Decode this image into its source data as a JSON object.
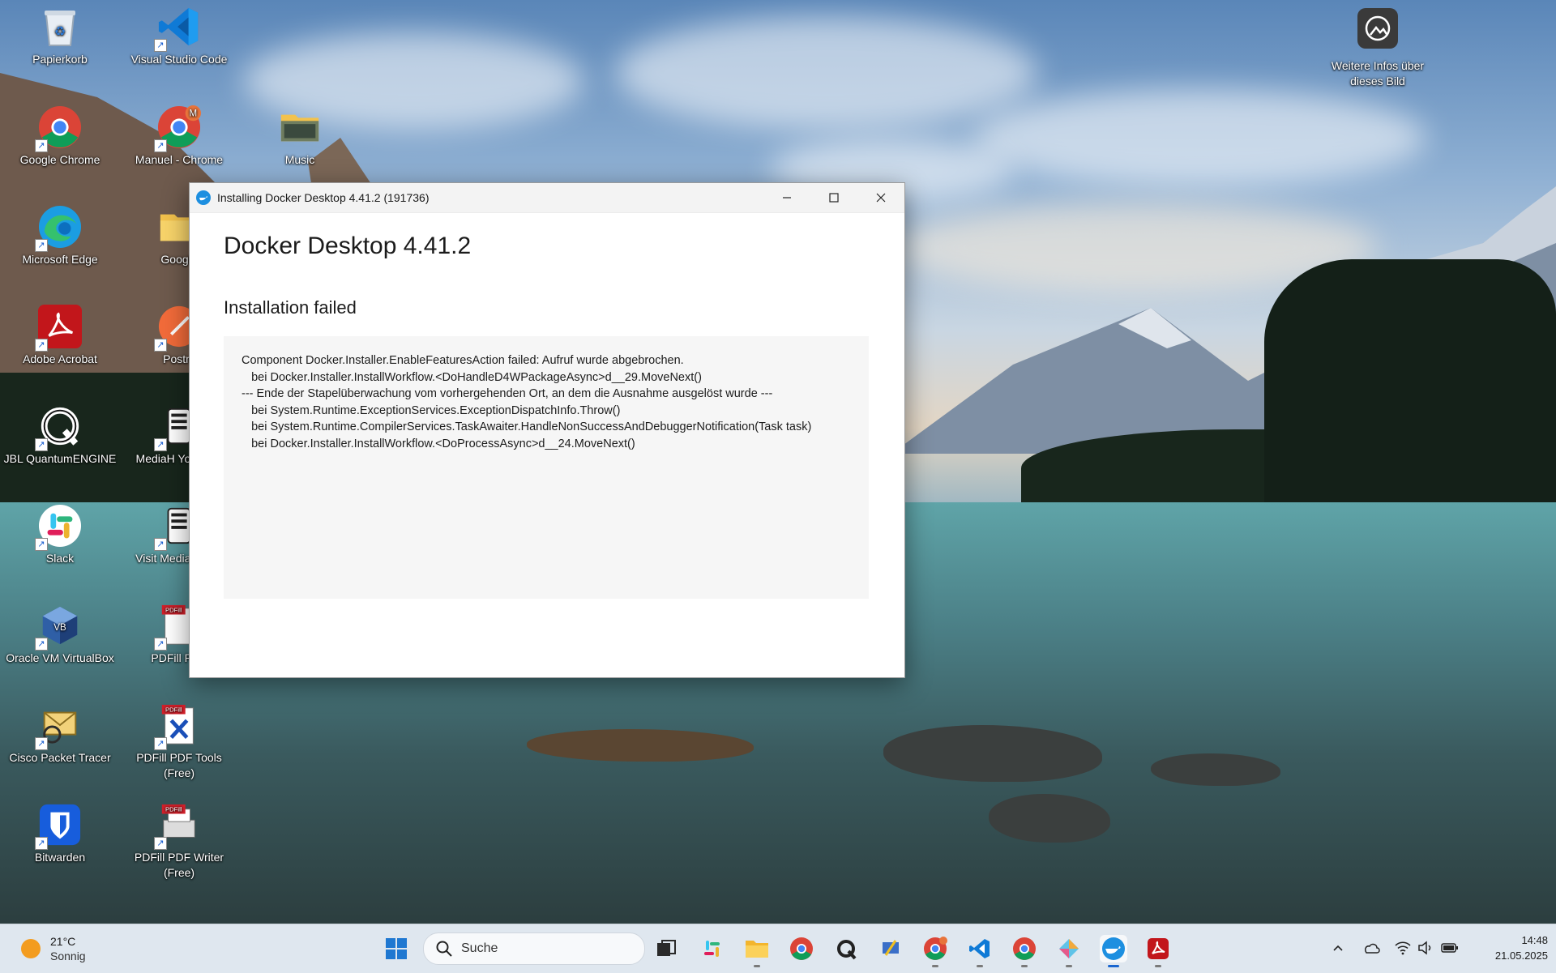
{
  "desktop": {
    "icons": [
      {
        "label": "Papierkorb"
      },
      {
        "label": "Visual Studio Code"
      },
      {
        "label": "Google Chrome"
      },
      {
        "label": "Manuel - Chrome"
      },
      {
        "label": "Music"
      },
      {
        "label": "Microsoft Edge"
      },
      {
        "label": "Google"
      },
      {
        "label": "Adobe Acrobat"
      },
      {
        "label": "Postm"
      },
      {
        "label": "JBL QuantumENGINE"
      },
      {
        "label": "MediaH YouTube"
      },
      {
        "label": "Slack"
      },
      {
        "label": "Visit Media Webs"
      },
      {
        "label": "Oracle VM VirtualBox"
      },
      {
        "label": "PDFill PDF"
      },
      {
        "label": "Cisco Packet Tracer"
      },
      {
        "label": "PDFill PDF Tools (Free)"
      },
      {
        "label": "Bitwarden"
      },
      {
        "label": "PDFill PDF Writer (Free)"
      }
    ],
    "spotlight_label": "Weitere Infos über dieses Bild"
  },
  "window": {
    "title": "Installing Docker Desktop 4.41.2 (191736)",
    "product": "Docker Desktop  4.41.2",
    "status": "Installation failed",
    "error_lines": [
      "Component Docker.Installer.EnableFeaturesAction failed: Aufruf wurde abgebrochen.",
      "   bei Docker.Installer.InstallWorkflow.<DoHandleD4WPackageAsync>d__29.MoveNext()",
      "--- Ende der Stapelüberwachung vom vorhergehenden Ort, an dem die Ausnahme ausgelöst wurde ---",
      "   bei System.Runtime.ExceptionServices.ExceptionDispatchInfo.Throw()",
      "   bei System.Runtime.CompilerServices.TaskAwaiter.HandleNonSuccessAndDebuggerNotification(Task task)",
      "   bei Docker.Installer.InstallWorkflow.<DoProcessAsync>d__24.MoveNext()"
    ],
    "controls": {
      "minimize": "—",
      "maximize": "☐",
      "close": "✕"
    }
  },
  "taskbar": {
    "weather_temp": "21°C",
    "weather_desc": "Sonnig",
    "search_placeholder": "Suche",
    "time": "14:48",
    "date": "21.05.2025"
  },
  "colors": {
    "accent": "#1a66d0",
    "docker_blue": "#1d8fe0",
    "taskbar_bg": "#dfe7ef"
  }
}
